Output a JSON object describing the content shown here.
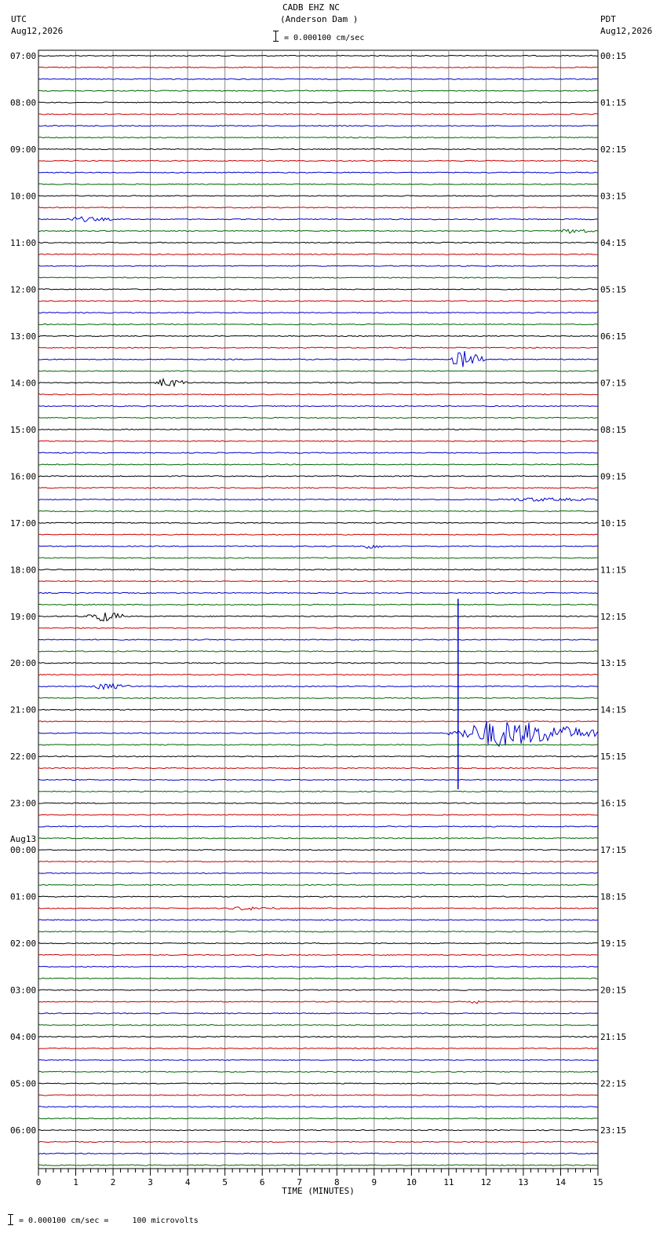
{
  "header": {
    "station_line": "CADB EHZ NC",
    "location_line": "(Anderson Dam )",
    "scale_text": "= 0.000100 cm/sec",
    "left_zone": "UTC",
    "left_date": "Aug12,2026",
    "right_zone": "PDT",
    "right_date": "Aug12,2026"
  },
  "footer": {
    "scale_text": "= 0.000100 cm/sec =     100 microvolts"
  },
  "colors": {
    "trace_cycle": [
      "#000000",
      "#cc0000",
      "#0000cc",
      "#006600"
    ],
    "grid": "#888888"
  },
  "chart_data": {
    "type": "line",
    "xlabel": "TIME (MINUTES)",
    "xlim": [
      0,
      15
    ],
    "x_ticks": [
      "0",
      "1",
      "2",
      "3",
      "4",
      "5",
      "6",
      "7",
      "8",
      "9",
      "10",
      "11",
      "12",
      "13",
      "14",
      "15"
    ],
    "rows_per_hour": 4,
    "row_count": 96,
    "left_hour_labels": [
      "07:00",
      "08:00",
      "09:00",
      "10:00",
      "11:00",
      "12:00",
      "13:00",
      "14:00",
      "15:00",
      "16:00",
      "17:00",
      "18:00",
      "19:00",
      "20:00",
      "21:00",
      "22:00",
      "23:00",
      "00:00",
      "01:00",
      "02:00",
      "03:00",
      "04:00",
      "05:00",
      "06:00"
    ],
    "date_change_label": "Aug13",
    "date_change_index": 17,
    "right_hour_labels": [
      "00:15",
      "01:15",
      "02:15",
      "03:15",
      "04:15",
      "05:15",
      "06:15",
      "07:15",
      "08:15",
      "09:15",
      "10:15",
      "11:15",
      "12:15",
      "13:15",
      "14:15",
      "15:15",
      "16:15",
      "17:15",
      "18:15",
      "19:15",
      "20:15",
      "21:15",
      "22:15",
      "23:15"
    ],
    "events": [
      {
        "row": 15,
        "t_start": 13.9,
        "t_end": 15.0,
        "amp": 3
      },
      {
        "row": 14,
        "t_start": 0.7,
        "t_end": 2.0,
        "amp": 3
      },
      {
        "row": 26,
        "t_start": 11.0,
        "t_end": 12.0,
        "amp": 12
      },
      {
        "row": 28,
        "t_start": 3.1,
        "t_end": 4.0,
        "amp": 6
      },
      {
        "row": 38,
        "t_start": 12.3,
        "t_end": 15.0,
        "amp": 2
      },
      {
        "row": 42,
        "t_start": 8.7,
        "t_end": 9.2,
        "amp": 4
      },
      {
        "row": 48,
        "t_start": 1.3,
        "t_end": 2.3,
        "amp": 8
      },
      {
        "row": 54,
        "t_start": 1.4,
        "t_end": 2.5,
        "amp": 4
      },
      {
        "row": 58,
        "t_start": 11.0,
        "t_end": 15.0,
        "amp": 18
      },
      {
        "row": 73,
        "t_start": 5.0,
        "t_end": 6.5,
        "amp": 2
      },
      {
        "row": 81,
        "t_start": 11.6,
        "t_end": 11.9,
        "amp": 3
      }
    ],
    "big_spike": {
      "t": 11.25,
      "top_row": 46.5,
      "bottom_row": 62.8
    }
  }
}
